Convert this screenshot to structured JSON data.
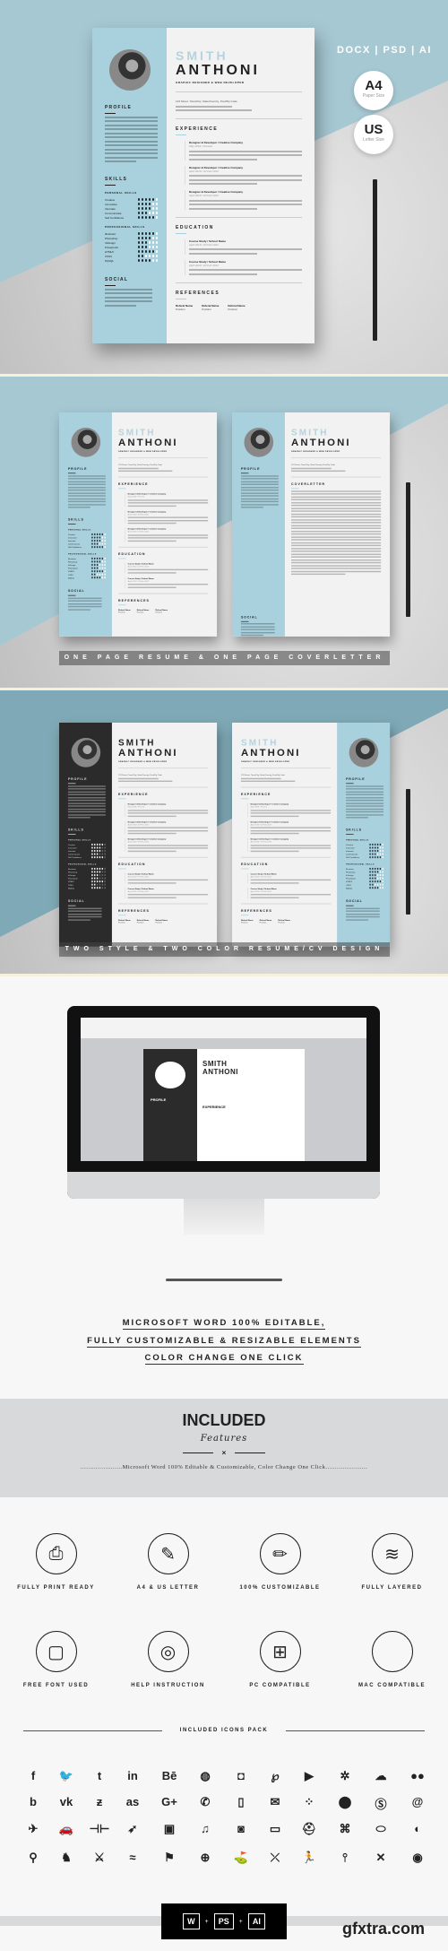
{
  "colors": {
    "accent_blue": "#a9d0dd",
    "dark": "#2b2b2b",
    "background": "#f7f7f7"
  },
  "resume": {
    "first_name": "SMITH",
    "last_name": "ANTHONI",
    "job_title": "GRAPHIC DESIGNER & WEB DEVELOPER",
    "address": "123 Street, Town/City, State/Country, Post/Zip Code",
    "sections": {
      "profile": "PROFILE",
      "skills": "SKILLS",
      "personal_skills": "PERSONAL SKILLS",
      "professional_skills": "PROFESSIONAL SKILLS",
      "social": "SOCIAL",
      "experience": "EXPERIENCE",
      "education": "EDUCATION",
      "references": "REFERENCES",
      "coverletter": "COVERLETTER"
    },
    "personal_skills": [
      {
        "name": "Creative",
        "level": 5
      },
      {
        "name": "Innovative",
        "level": 4
      },
      {
        "name": "Internate",
        "level": 4
      },
      {
        "name": "Communicate",
        "level": 3
      },
      {
        "name": "Self Confidence",
        "level": 5
      }
    ],
    "professional_skills": [
      {
        "name": "Illustrator",
        "level": 5
      },
      {
        "name": "Photoshop",
        "level": 4
      },
      {
        "name": "InDesign",
        "level": 3
      },
      {
        "name": "Powerpoint",
        "level": 3
      },
      {
        "name": "HTML5",
        "level": 5
      },
      {
        "name": "CSS3",
        "level": 2
      },
      {
        "name": "MySQL",
        "level": 4
      }
    ],
    "experience": [
      {
        "title": "Designer & Developer / Creative Company",
        "date": "May 2019 / Present"
      },
      {
        "title": "Designer & Developer / Creative Company",
        "date": "April 2019 / 20 Feb 2012"
      },
      {
        "title": "Designer & Developer / Creative Company",
        "date": "April 2019 / 20 Feb 2012"
      }
    ],
    "education": [
      {
        "title": "Course Study / School Name",
        "date": "April 2019 / 20 Feb 2012"
      },
      {
        "title": "Course Study / School Name",
        "date": "April 2019 / 20 Feb 2012"
      }
    ],
    "references": [
      {
        "name": "Referal Name",
        "position": "Position"
      },
      {
        "name": "Referal Name",
        "position": "Position"
      },
      {
        "name": "Referal Name",
        "position": "Position"
      }
    ]
  },
  "hero": {
    "formats": "DOCX | PSD | AI",
    "a4": {
      "big": "A4",
      "small": "Paper Size"
    },
    "us": {
      "big": "US",
      "small": "Letter Size"
    }
  },
  "captions": {
    "section2": "ONE PAGE RESUME & ONE PAGE COVERLETTER",
    "section3": "TWO STYLE & TWO COLOR RESUME/CV DESIGN"
  },
  "editable_lines": [
    "MICROSOFT WORD 100% EDITABLE,",
    "FULLY CUSTOMIZABLE & RESIZABLE ELEMENTS",
    "COLOR CHANGE ONE CLICK"
  ],
  "included": {
    "title": "INCLUDED",
    "subtitle": "Features",
    "separator": "×",
    "tagline": "......................Microsoft Word 100% Editable & Customizable, Color Change One Click......................"
  },
  "features": [
    {
      "label": "FULLY PRINT READY",
      "icon": "printer-icon",
      "glyph": "⎙"
    },
    {
      "label": "A4 & US LETTER",
      "icon": "document-edit-icon",
      "glyph": "✎"
    },
    {
      "label": "100% CUSTOMIZABLE",
      "icon": "pencil-icon",
      "glyph": "✏"
    },
    {
      "label": "FULLY LAYERED",
      "icon": "layers-icon",
      "glyph": "≋"
    },
    {
      "label": "FREE FONT USED",
      "icon": "vector-square-icon",
      "glyph": "▢"
    },
    {
      "label": "HELP INSTRUCTION",
      "icon": "lifebuoy-icon",
      "glyph": "◎"
    },
    {
      "label": "PC COMPATIBLE",
      "icon": "windows-icon",
      "glyph": "⊞"
    },
    {
      "label": "MAC COMPATIBLE",
      "icon": "apple-icon",
      "glyph": ""
    }
  ],
  "icons_pack": {
    "title": "INCLUDED ICONS PACK",
    "rows": [
      [
        [
          "facebook-icon",
          "f"
        ],
        [
          "twitter-icon",
          "🐦"
        ],
        [
          "tumblr-icon",
          "t"
        ],
        [
          "linkedin-icon",
          "in"
        ],
        [
          "behance-icon",
          "Bē"
        ],
        [
          "dribbble-icon",
          "◍"
        ],
        [
          "instagram-icon",
          "◘"
        ],
        [
          "pinterest-icon",
          "℘"
        ],
        [
          "youtube-icon",
          "▶"
        ],
        [
          "yelp-icon",
          "✲"
        ],
        [
          "soundcloud-icon",
          "☁"
        ],
        [
          "flickr-icon",
          "●●"
        ]
      ],
      [
        [
          "blogger-icon",
          "b"
        ],
        [
          "vk-icon",
          "vk"
        ],
        [
          "deviantart-icon",
          "ƶ"
        ],
        [
          "lastfm-icon",
          "as"
        ],
        [
          "google-plus-icon",
          "G+"
        ],
        [
          "phone-icon",
          "✆"
        ],
        [
          "mobile-icon",
          "▯"
        ],
        [
          "mail-icon",
          "✉"
        ],
        [
          "loading-icon",
          "⁘"
        ],
        [
          "location-pin-icon",
          "⬤"
        ],
        [
          "skype-icon",
          "Ⓢ"
        ],
        [
          "at-icon",
          "@"
        ]
      ],
      [
        [
          "airplane-icon",
          "✈"
        ],
        [
          "car-icon",
          "🚗"
        ],
        [
          "dumbbell-icon",
          "⊣⊢"
        ],
        [
          "archery-icon",
          "➶"
        ],
        [
          "film-icon",
          "▣"
        ],
        [
          "music-icon",
          "♫"
        ],
        [
          "camera-icon",
          "◙"
        ],
        [
          "video-camera-icon",
          "▭"
        ],
        [
          "football-helmet-icon",
          "⛑"
        ],
        [
          "gamepad-icon",
          "⌘"
        ],
        [
          "american-football-icon",
          "⬭"
        ],
        [
          "volleyball-icon",
          "◐"
        ]
      ],
      [
        [
          "bicycle-icon",
          "⚲"
        ],
        [
          "chess-knight-icon",
          "♞"
        ],
        [
          "fencing-icon",
          "⚔"
        ],
        [
          "swimming-icon",
          "≈"
        ],
        [
          "badminton-icon",
          "⚑"
        ],
        [
          "basketball-icon",
          "⊕"
        ],
        [
          "golf-icon",
          "⛳"
        ],
        [
          "kayak-icon",
          "⤫"
        ],
        [
          "running-icon",
          "🏃"
        ],
        [
          "bowling-icon",
          "⫯"
        ],
        [
          "hockey-icon",
          "✕"
        ],
        [
          "target-icon",
          "◉"
        ]
      ]
    ]
  },
  "footer": {
    "formats": [
      "W",
      "PS",
      "AI"
    ],
    "plus": "+",
    "watermark": "gfxtra.com"
  },
  "monitor": {
    "doc_first": "SMITH",
    "doc_last": "ANTHONI",
    "doc_heading1": "PROFILE",
    "doc_heading2": "EXPERIENCE"
  }
}
